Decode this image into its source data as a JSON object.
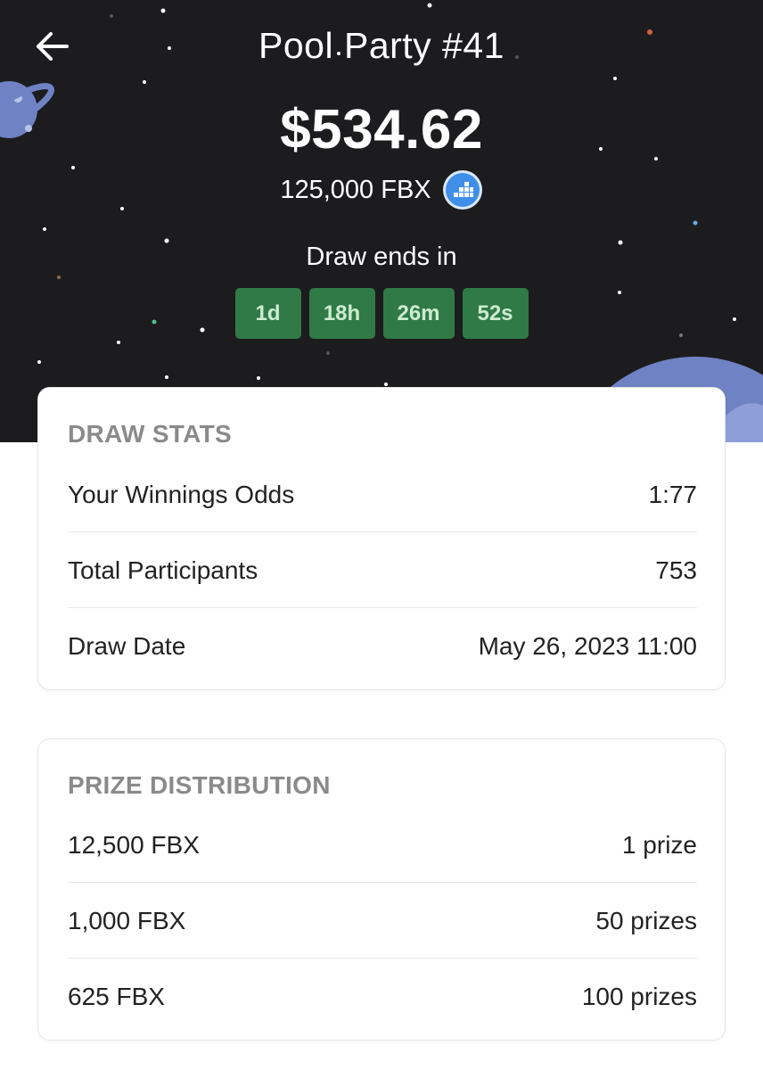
{
  "header": {
    "title": "Pool Party #41",
    "prize_amount": "$534.62",
    "token_amount": "125,000 FBX",
    "draw_ends_label": "Draw ends in"
  },
  "countdown": [
    {
      "value": "1d"
    },
    {
      "value": "18h"
    },
    {
      "value": "26m"
    },
    {
      "value": "52s"
    }
  ],
  "draw_stats": {
    "title": "DRAW STATS",
    "rows": [
      {
        "label": "Your Winnings Odds",
        "value": "1:77"
      },
      {
        "label": "Total Participants",
        "value": "753"
      },
      {
        "label": "Draw Date",
        "value": "May 26, 2023 11:00"
      }
    ]
  },
  "prize_distribution": {
    "title": "PRIZE DISTRIBUTION",
    "rows": [
      {
        "label": "12,500 FBX",
        "value": "1 prize"
      },
      {
        "label": "1,000 FBX",
        "value": "50 prizes"
      },
      {
        "label": "625 FBX",
        "value": "100 prizes"
      }
    ]
  },
  "icons": {
    "back": "arrow-left-icon",
    "token": "fbx-coin-icon"
  },
  "colors": {
    "hero_background": "#1c1c1f",
    "countdown_box": "#2f7a46",
    "countdown_text": "#cdeccf",
    "planet": "#6f82c4",
    "coin": "#3f8fe8"
  }
}
